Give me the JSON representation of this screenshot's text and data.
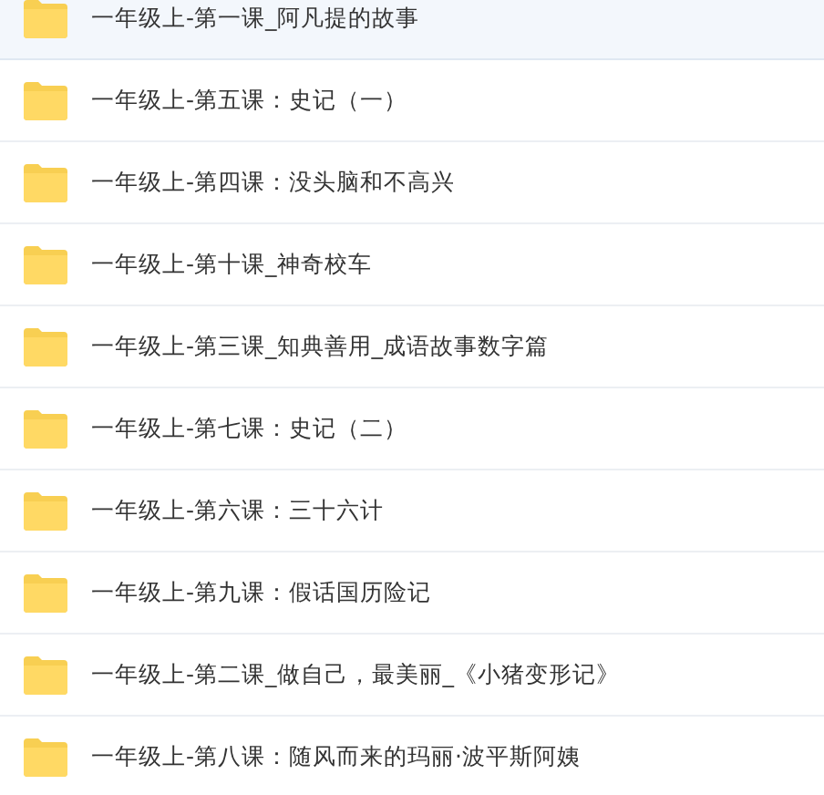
{
  "folders": [
    {
      "name": "一年级上-第一课_阿凡提的故事",
      "selected": true
    },
    {
      "name": "一年级上-第五课：史记（一）",
      "selected": false
    },
    {
      "name": "一年级上-第四课：没头脑和不高兴",
      "selected": false
    },
    {
      "name": "一年级上-第十课_神奇校车",
      "selected": false
    },
    {
      "name": "一年级上-第三课_知典善用_成语故事数字篇",
      "selected": false
    },
    {
      "name": "一年级上-第七课：史记（二）",
      "selected": false
    },
    {
      "name": "一年级上-第六课：三十六计",
      "selected": false
    },
    {
      "name": "一年级上-第九课：假话国历险记",
      "selected": false
    },
    {
      "name": "一年级上-第二课_做自己，最美丽_《小猪变形记》",
      "selected": false
    },
    {
      "name": "一年级上-第八课：随风而来的玛丽·波平斯阿姨",
      "selected": false
    }
  ]
}
